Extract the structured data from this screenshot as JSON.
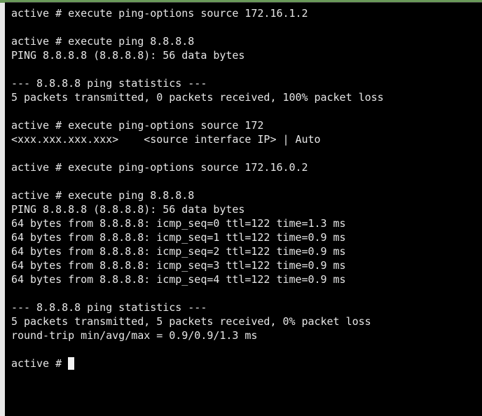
{
  "terminal": {
    "lines": [
      "active # execute ping-options source 172.16.1.2",
      "",
      "active # execute ping 8.8.8.8",
      "PING 8.8.8.8 (8.8.8.8): 56 data bytes",
      "",
      "--- 8.8.8.8 ping statistics ---",
      "5 packets transmitted, 0 packets received, 100% packet loss",
      "",
      "active # execute ping-options source 172",
      "<xxx.xxx.xxx.xxx>    <source interface IP> | Auto",
      "",
      "active # execute ping-options source 172.16.0.2",
      "",
      "active # execute ping 8.8.8.8",
      "PING 8.8.8.8 (8.8.8.8): 56 data bytes",
      "64 bytes from 8.8.8.8: icmp_seq=0 ttl=122 time=1.3 ms",
      "64 bytes from 8.8.8.8: icmp_seq=1 ttl=122 time=0.9 ms",
      "64 bytes from 8.8.8.8: icmp_seq=2 ttl=122 time=0.9 ms",
      "64 bytes from 8.8.8.8: icmp_seq=3 ttl=122 time=0.9 ms",
      "64 bytes from 8.8.8.8: icmp_seq=4 ttl=122 time=0.9 ms",
      "",
      "--- 8.8.8.8 ping statistics ---",
      "5 packets transmitted, 5 packets received, 0% packet loss",
      "round-trip min/avg/max = 0.9/0.9/1.3 ms",
      ""
    ],
    "prompt": "active # "
  },
  "colors": {
    "background": "#000000",
    "foreground": "#e6e6e6",
    "cursor": "#f2f2f2"
  }
}
